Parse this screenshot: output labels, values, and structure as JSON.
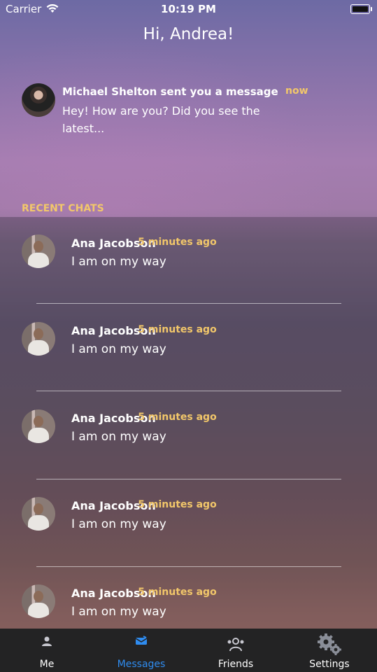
{
  "status_bar": {
    "carrier": "Carrier",
    "time": "10:19 PM"
  },
  "header": {
    "greeting": "Hi, Andrea!"
  },
  "notification": {
    "title": "Michael Shelton sent you a message",
    "time": "now",
    "body": "Hey! How are you? Did you see the latest..."
  },
  "recent_chats": {
    "heading": "RECENT CHATS",
    "items": [
      {
        "name": "Ana Jacobson",
        "message": "I am on my way",
        "time": "5 minutes ago"
      },
      {
        "name": "Ana Jacobson",
        "message": "I am on my way",
        "time": "5 minutes ago"
      },
      {
        "name": "Ana Jacobson",
        "message": "I am on my way",
        "time": "5 minutes ago"
      },
      {
        "name": "Ana Jacobson",
        "message": "I am on my way",
        "time": "5 minutes ago"
      },
      {
        "name": "Ana Jacobson",
        "message": "I am on my way",
        "time": "5 minutes ago"
      }
    ]
  },
  "tab_bar": {
    "tabs": [
      {
        "label": "Me",
        "icon": "person-icon"
      },
      {
        "label": "Messages",
        "icon": "messages-icon"
      },
      {
        "label": "Friends",
        "icon": "friends-icon"
      },
      {
        "label": "Settings",
        "icon": "gear-icon"
      }
    ],
    "active": "Messages",
    "active_color": "#2f8cf0"
  },
  "colors": {
    "accent": "#f2c76a",
    "tab_bar_bg": "#232324"
  }
}
